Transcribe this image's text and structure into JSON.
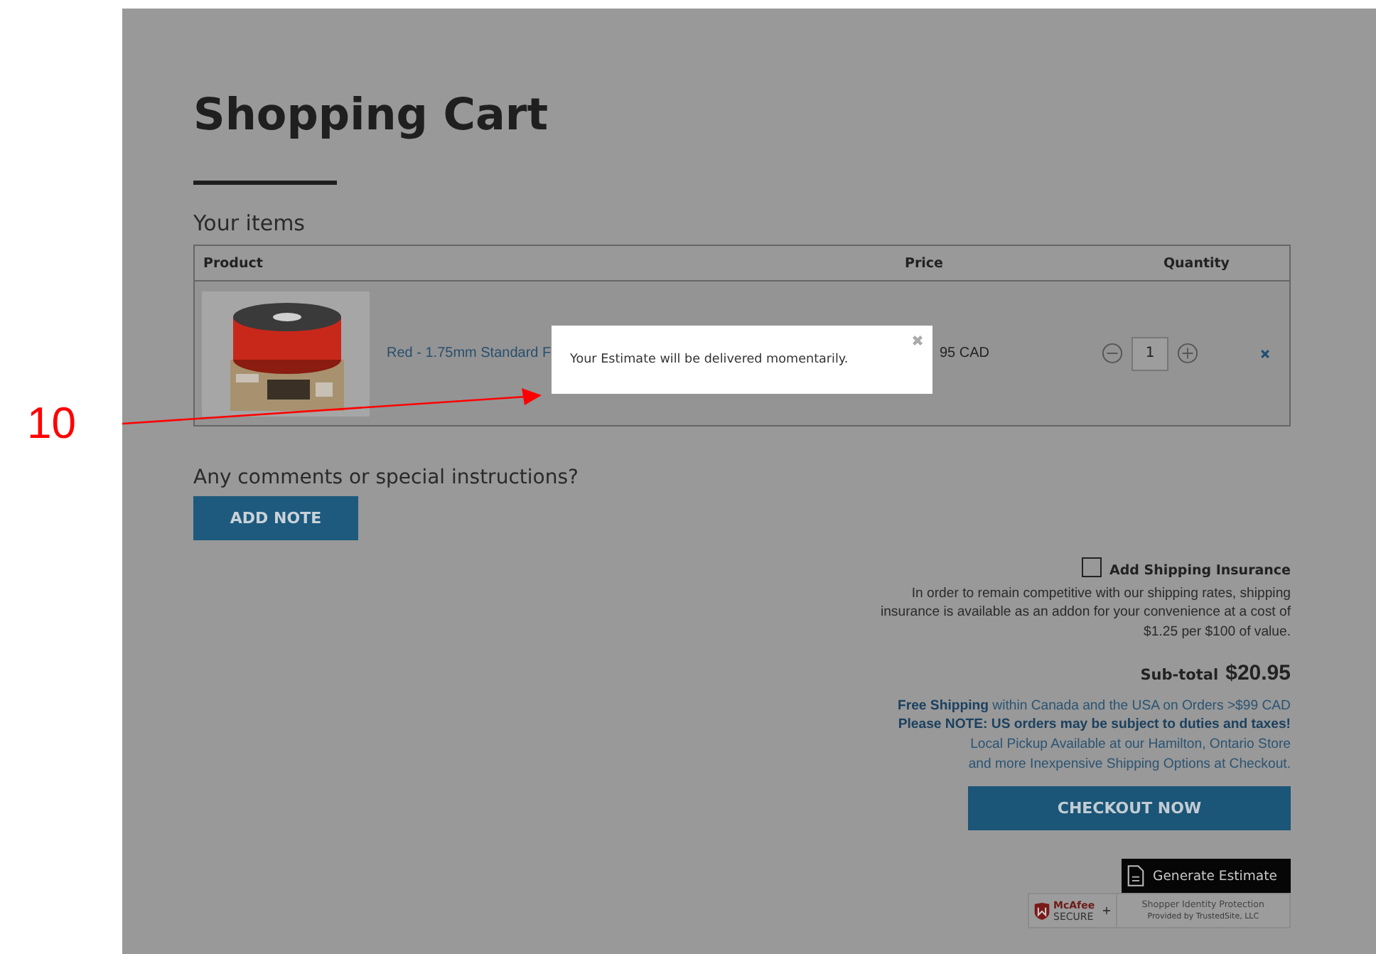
{
  "page": {
    "title": "Shopping Cart",
    "section_title": "Your items"
  },
  "table": {
    "columns": [
      "Product",
      "Price",
      "Quantity"
    ],
    "rows": [
      {
        "product": "Red - 1.75mm Standard F",
        "price": "95 CAD",
        "quantity": "1"
      }
    ]
  },
  "modal": {
    "message": "Your Estimate will be delivered momentarily."
  },
  "notes": {
    "label": "Any comments or special instructions?",
    "button": "ADD NOTE"
  },
  "insurance": {
    "label": "Add Shipping Insurance",
    "checked": false,
    "description": "In order to remain competitive with our shipping rates, shipping insurance is available as an addon for your convenience at a cost of $1.25 per $100 of value."
  },
  "subtotal": {
    "label": "Sub-total",
    "amount": "$20.95"
  },
  "shipping_info": [
    {
      "text": "**Free Shipping** within Canada and the USA on Orders >$99 CAD",
      "bold": false
    },
    {
      "text": "Please NOTE: US orders may be subject to duties and taxes!",
      "bold": true
    },
    {
      "text": "Local Pickup Available at our Hamilton, Ontario Store",
      "bold": false
    },
    {
      "text": "and more Inexpensive Shipping Options at Checkout.",
      "bold": false
    }
  ],
  "checkout_button": "CHECKOUT NOW",
  "estimate_button": "Generate Estimate",
  "trust_badge": {
    "brand": "McAfee",
    "secure": "SECURE",
    "plus": "+",
    "title": "Shopper Identity Protection",
    "subtitle": "Provided by TrustedSite, LLC"
  },
  "annotation": {
    "label": "10"
  }
}
